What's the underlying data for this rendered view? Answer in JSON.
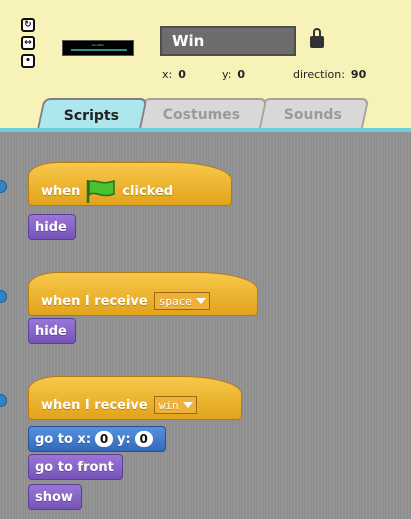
{
  "sprite": {
    "name": "Win",
    "x_label": "x:",
    "x": "0",
    "y_label": "y:",
    "y": "0",
    "direction_label": "direction:",
    "direction": "90",
    "thumbnail_label": "You Win!"
  },
  "tabs": [
    {
      "label": "Scripts",
      "active": true
    },
    {
      "label": "Costumes",
      "active": false
    },
    {
      "label": "Sounds",
      "active": false
    }
  ],
  "icons": {
    "rotate": "rotate-all-around-icon",
    "flip": "left-right-flip-icon",
    "no_rotate": "no-rotation-icon",
    "lock": "lock-icon",
    "flag": "green-flag-icon"
  },
  "colors": {
    "control": "#e6a822",
    "looks": "#8a67cc",
    "motion": "#4a80d0",
    "tab_active": "#aee6ee",
    "script_area": "#8f8f8f"
  },
  "scripts": [
    {
      "hat": {
        "before": "when",
        "after": "clicked"
      },
      "blocks": [
        {
          "label": "hide"
        }
      ]
    },
    {
      "hat": {
        "text": "when I receive",
        "message": "space"
      },
      "blocks": [
        {
          "label": "hide"
        }
      ]
    },
    {
      "hat": {
        "text": "when I receive",
        "message": "win"
      },
      "blocks": [
        {
          "label": "go to x:",
          "y_label": "y:",
          "x": "0",
          "y": "0"
        },
        {
          "label": "go to front"
        },
        {
          "label": "show"
        }
      ]
    }
  ]
}
